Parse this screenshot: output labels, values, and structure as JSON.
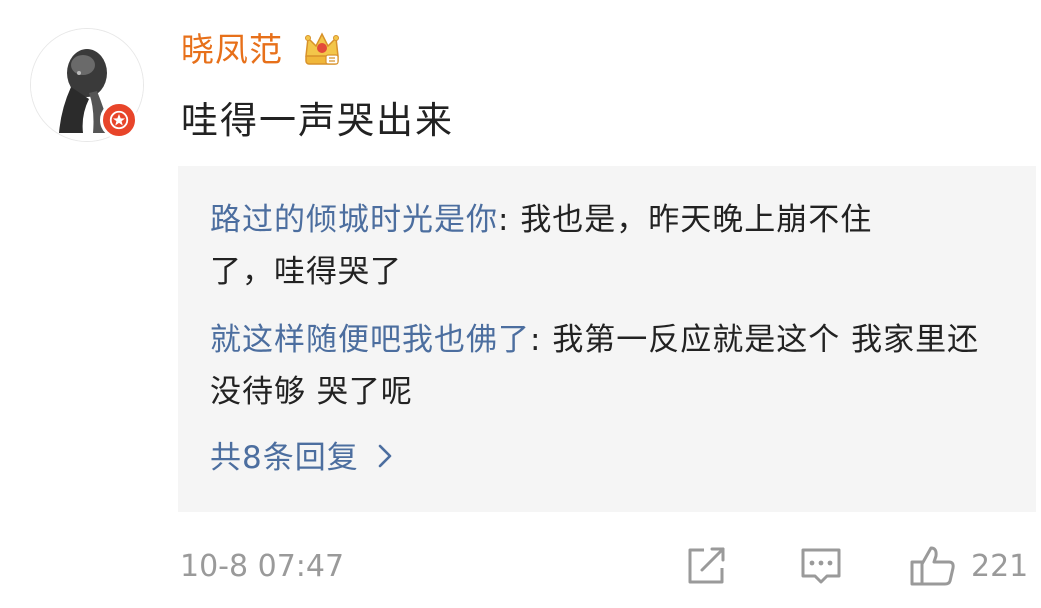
{
  "comment": {
    "username": "晓凤范",
    "text": "哇得一声哭出来",
    "timestamp": "10-8 07:47",
    "like_count": "221"
  },
  "replies": [
    {
      "author": "路过的倾城时光是你",
      "separator": ": ",
      "text": "我也是，昨天晚上崩不住了，哇得哭了"
    },
    {
      "author": "就这样随便吧我也佛了",
      "separator": ": ",
      "text": "我第一反应就是这个  我家里还没待够  哭了呢"
    }
  ],
  "more_replies": "共8条回复",
  "icons": {
    "verified": "verified-star-icon",
    "crown": "crown-icon",
    "share": "share-icon",
    "comment": "comment-icon",
    "like": "thumbs-up-icon",
    "chevron": "chevron-right-icon"
  },
  "colors": {
    "username": "#e7701a",
    "link": "#4c6e9f",
    "meta": "#9a9a9a",
    "verified_badge": "#e8452a",
    "reply_bg": "#f5f5f5"
  }
}
